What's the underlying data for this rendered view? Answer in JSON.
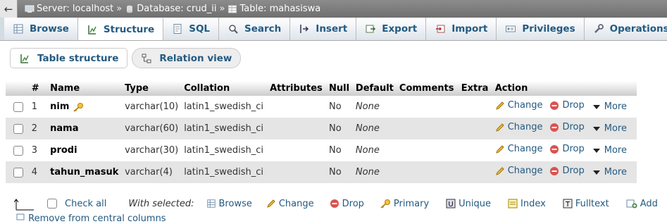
{
  "breadcrumb": {
    "back": "←",
    "server": "Server: localhost",
    "database": "Database: crud_ii",
    "table": "Table: mahasiswa",
    "separator": "»"
  },
  "tabs": [
    {
      "label": "Browse",
      "icon": "browse-icon",
      "active": false
    },
    {
      "label": "Structure",
      "icon": "structure-icon",
      "active": true
    },
    {
      "label": "SQL",
      "icon": "sql-icon",
      "active": false
    },
    {
      "label": "Search",
      "icon": "search-icon",
      "active": false
    },
    {
      "label": "Insert",
      "icon": "insert-icon",
      "active": false
    },
    {
      "label": "Export",
      "icon": "export-icon",
      "active": false
    },
    {
      "label": "Import",
      "icon": "import-icon",
      "active": false
    },
    {
      "label": "Privileges",
      "icon": "privileges-icon",
      "active": false
    },
    {
      "label": "Operations",
      "icon": "operations-icon",
      "active": false
    }
  ],
  "subtabs": {
    "table_structure": "Table structure",
    "relation_view": "Relation view"
  },
  "columns": [
    "#",
    "Name",
    "Type",
    "Collation",
    "Attributes",
    "Null",
    "Default",
    "Comments",
    "Extra",
    "Action"
  ],
  "rows": [
    {
      "num": "1",
      "name": "nim",
      "type": "varchar(10)",
      "collation": "latin1_swedish_ci",
      "attributes": "",
      "null": "No",
      "default": "None",
      "comments": "",
      "extra": "",
      "primary": true
    },
    {
      "num": "2",
      "name": "nama",
      "type": "varchar(60)",
      "collation": "latin1_swedish_ci",
      "attributes": "",
      "null": "No",
      "default": "None",
      "comments": "",
      "extra": "",
      "primary": false
    },
    {
      "num": "3",
      "name": "prodi",
      "type": "varchar(30)",
      "collation": "latin1_swedish_ci",
      "attributes": "",
      "null": "No",
      "default": "None",
      "comments": "",
      "extra": "",
      "primary": false
    },
    {
      "num": "4",
      "name": "tahun_masuk",
      "type": "varchar(4)",
      "collation": "latin1_swedish_ci",
      "attributes": "",
      "null": "No",
      "default": "None",
      "comments": "",
      "extra": "",
      "primary": false
    }
  ],
  "actions": {
    "change": "Change",
    "drop": "Drop",
    "more": "More"
  },
  "bottom": {
    "check_all": "Check all",
    "with_selected": "With selected:",
    "browse": "Browse",
    "change": "Change",
    "drop": "Drop",
    "primary": "Primary",
    "unique": "Unique",
    "index": "Index",
    "fulltext": "Fulltext",
    "add": "Add",
    "remove_central": "Remove from central columns"
  },
  "colors": {
    "link": "#235a81",
    "header_bar": "#7d7d7d",
    "tab_bg": "#d3dce3",
    "even_row": "#e5e5e5"
  }
}
